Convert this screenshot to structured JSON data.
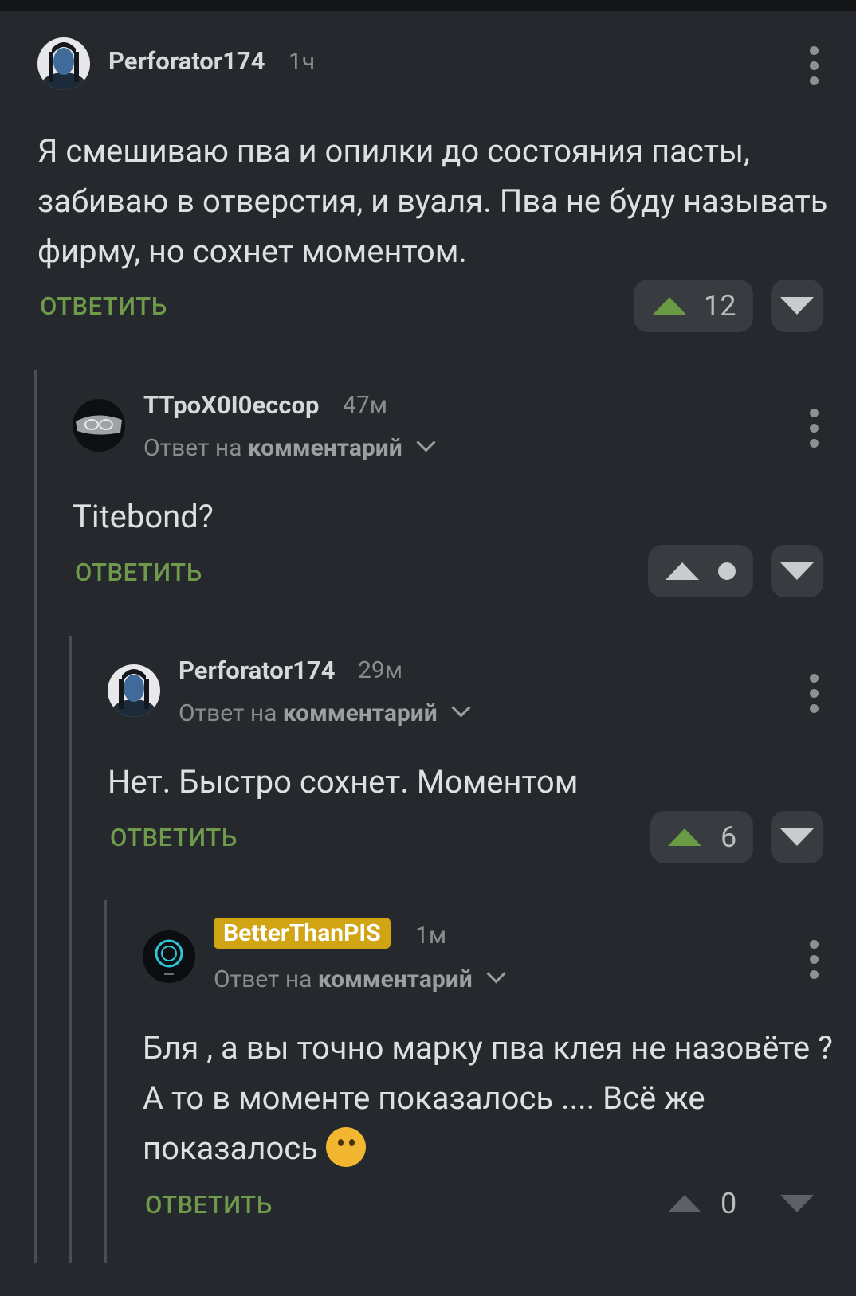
{
  "comments": [
    {
      "username": "Perforator174",
      "time": "1ч",
      "text": "Я смешиваю пва и опилки до состояния пасты, забиваю в отверстия, и вуаля. Пва не буду называть фирму, но сохнет моментом.",
      "reply_label": "ОТВЕТИТЬ",
      "score": "12"
    },
    {
      "username": "ТТроХ0I0еccop",
      "time": "47м",
      "reply_to_prefix": "Ответ на",
      "reply_to_link": "комментарий",
      "text": "Titebond?",
      "reply_label": "ОТВЕТИТЬ"
    },
    {
      "username": "Perforator174",
      "time": "29м",
      "reply_to_prefix": "Ответ на",
      "reply_to_link": "комментарий",
      "text": "Нет. Быстро сохнет. Моментом",
      "reply_label": "ОТВЕТИТЬ",
      "score": "6"
    },
    {
      "username": "BetterThanPIS",
      "time": "1м",
      "reply_to_prefix": "Ответ на",
      "reply_to_link": "комментарий",
      "text": "Бля , а вы точно марку пва клея не назовёте ? А то в моменте показалось .... Всё же показалось",
      "emoji": "thinking-face",
      "reply_label": "ОТВЕТИТЬ",
      "score": "0"
    }
  ],
  "colors": {
    "background": "#25282c",
    "upvote_green": "#6a9a43",
    "reply_green": "#6f9a4c",
    "badge_gold": "#d1a413"
  }
}
